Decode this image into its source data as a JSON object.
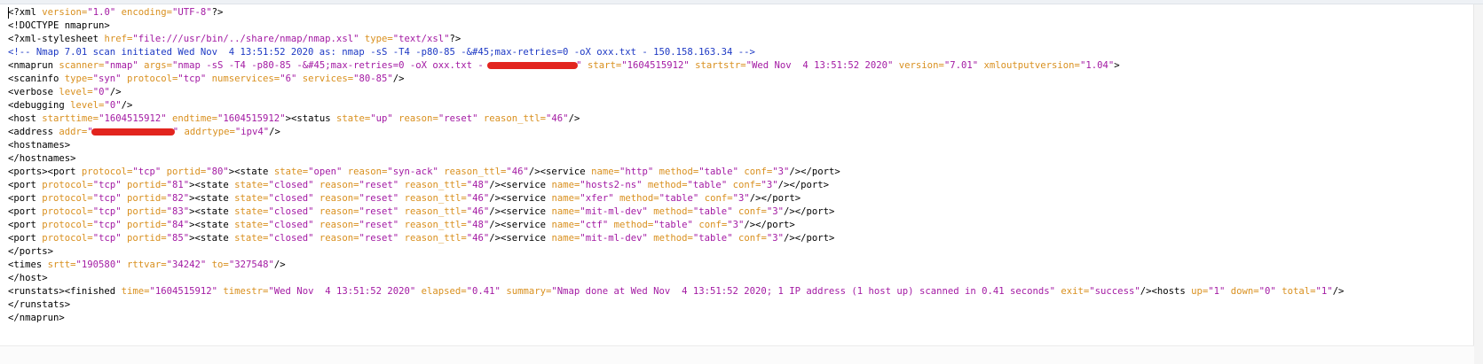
{
  "colors": {
    "text": "#000000",
    "attribute": "#d9901f",
    "value": "#a31aa3",
    "comment": "#1d39c4",
    "redaction": "#e2241e"
  },
  "lines": [
    [
      [
        "t",
        "<?xml "
      ],
      [
        "a",
        "version="
      ],
      [
        "v",
        "\"1.0\""
      ],
      [
        "t",
        " "
      ],
      [
        "a",
        "encoding="
      ],
      [
        "v",
        "\"UTF-8\""
      ],
      [
        "t",
        "?>"
      ]
    ],
    [
      [
        "t",
        "<!DOCTYPE nmaprun>"
      ]
    ],
    [
      [
        "t",
        "<?xml-stylesheet "
      ],
      [
        "a",
        "href="
      ],
      [
        "v",
        "\"file:///usr/bin/../share/nmap/nmap.xsl\""
      ],
      [
        "t",
        " "
      ],
      [
        "a",
        "type="
      ],
      [
        "v",
        "\"text/xsl\""
      ],
      [
        "t",
        "?>"
      ]
    ],
    [
      [
        "c",
        "<!-- Nmap 7.01 scan initiated Wed Nov  4 13:51:52 2020 as: nmap -sS -T4 -p80-85 -&#45;max-retries=0 -oX oxx.txt - 150.158.163.34 -->"
      ]
    ],
    [
      [
        "t",
        "<nmaprun "
      ],
      [
        "a",
        "scanner="
      ],
      [
        "v",
        "\"nmap\""
      ],
      [
        "t",
        " "
      ],
      [
        "a",
        "args="
      ],
      [
        "v",
        "\"nmap -sS -T4 -p80-85 -&#45;max-retries=0 -oX oxx.txt - "
      ],
      [
        "r",
        "102"
      ],
      [
        "v",
        "\""
      ],
      [
        "t",
        " "
      ],
      [
        "a",
        "start="
      ],
      [
        "v",
        "\"1604515912\""
      ],
      [
        "t",
        " "
      ],
      [
        "a",
        "startstr="
      ],
      [
        "v",
        "\"Wed Nov  4 13:51:52 2020\""
      ],
      [
        "t",
        " "
      ],
      [
        "a",
        "version="
      ],
      [
        "v",
        "\"7.01\""
      ],
      [
        "t",
        " "
      ],
      [
        "a",
        "xmloutputversion="
      ],
      [
        "v",
        "\"1.04\""
      ],
      [
        "t",
        ">"
      ]
    ],
    [
      [
        "t",
        "<scaninfo "
      ],
      [
        "a",
        "type="
      ],
      [
        "v",
        "\"syn\""
      ],
      [
        "t",
        " "
      ],
      [
        "a",
        "protocol="
      ],
      [
        "v",
        "\"tcp\""
      ],
      [
        "t",
        " "
      ],
      [
        "a",
        "numservices="
      ],
      [
        "v",
        "\"6\""
      ],
      [
        "t",
        " "
      ],
      [
        "a",
        "services="
      ],
      [
        "v",
        "\"80-85\""
      ],
      [
        "t",
        "/>"
      ]
    ],
    [
      [
        "t",
        "<verbose "
      ],
      [
        "a",
        "level="
      ],
      [
        "v",
        "\"0\""
      ],
      [
        "t",
        "/>"
      ]
    ],
    [
      [
        "t",
        "<debugging "
      ],
      [
        "a",
        "level="
      ],
      [
        "v",
        "\"0\""
      ],
      [
        "t",
        "/>"
      ]
    ],
    [
      [
        "t",
        "<host "
      ],
      [
        "a",
        "starttime="
      ],
      [
        "v",
        "\"1604515912\""
      ],
      [
        "t",
        " "
      ],
      [
        "a",
        "endtime="
      ],
      [
        "v",
        "\"1604515912\""
      ],
      [
        "t",
        "><status "
      ],
      [
        "a",
        "state="
      ],
      [
        "v",
        "\"up\""
      ],
      [
        "t",
        " "
      ],
      [
        "a",
        "reason="
      ],
      [
        "v",
        "\"reset\""
      ],
      [
        "t",
        " "
      ],
      [
        "a",
        "reason_ttl="
      ],
      [
        "v",
        "\"46\""
      ],
      [
        "t",
        "/>"
      ]
    ],
    [
      [
        "t",
        "<address "
      ],
      [
        "a",
        "addr="
      ],
      [
        "v",
        "\""
      ],
      [
        "r",
        "94"
      ],
      [
        "v",
        "\""
      ],
      [
        "t",
        " "
      ],
      [
        "a",
        "addrtype="
      ],
      [
        "v",
        "\"ipv4\""
      ],
      [
        "t",
        "/>"
      ]
    ],
    [
      [
        "t",
        "<hostnames>"
      ]
    ],
    [
      [
        "t",
        "</hostnames>"
      ]
    ],
    [
      [
        "t",
        "<ports><port "
      ],
      [
        "a",
        "protocol="
      ],
      [
        "v",
        "\"tcp\""
      ],
      [
        "t",
        " "
      ],
      [
        "a",
        "portid="
      ],
      [
        "v",
        "\"80\""
      ],
      [
        "t",
        "><state "
      ],
      [
        "a",
        "state="
      ],
      [
        "v",
        "\"open\""
      ],
      [
        "t",
        " "
      ],
      [
        "a",
        "reason="
      ],
      [
        "v",
        "\"syn-ack\""
      ],
      [
        "t",
        " "
      ],
      [
        "a",
        "reason_ttl="
      ],
      [
        "v",
        "\"46\""
      ],
      [
        "t",
        "/><service "
      ],
      [
        "a",
        "name="
      ],
      [
        "v",
        "\"http\""
      ],
      [
        "t",
        " "
      ],
      [
        "a",
        "method="
      ],
      [
        "v",
        "\"table\""
      ],
      [
        "t",
        " "
      ],
      [
        "a",
        "conf="
      ],
      [
        "v",
        "\"3\""
      ],
      [
        "t",
        "/></port>"
      ]
    ],
    [
      [
        "t",
        "<port "
      ],
      [
        "a",
        "protocol="
      ],
      [
        "v",
        "\"tcp\""
      ],
      [
        "t",
        " "
      ],
      [
        "a",
        "portid="
      ],
      [
        "v",
        "\"81\""
      ],
      [
        "t",
        "><state "
      ],
      [
        "a",
        "state="
      ],
      [
        "v",
        "\"closed\""
      ],
      [
        "t",
        " "
      ],
      [
        "a",
        "reason="
      ],
      [
        "v",
        "\"reset\""
      ],
      [
        "t",
        " "
      ],
      [
        "a",
        "reason_ttl="
      ],
      [
        "v",
        "\"48\""
      ],
      [
        "t",
        "/><service "
      ],
      [
        "a",
        "name="
      ],
      [
        "v",
        "\"hosts2-ns\""
      ],
      [
        "t",
        " "
      ],
      [
        "a",
        "method="
      ],
      [
        "v",
        "\"table\""
      ],
      [
        "t",
        " "
      ],
      [
        "a",
        "conf="
      ],
      [
        "v",
        "\"3\""
      ],
      [
        "t",
        "/></port>"
      ]
    ],
    [
      [
        "t",
        "<port "
      ],
      [
        "a",
        "protocol="
      ],
      [
        "v",
        "\"tcp\""
      ],
      [
        "t",
        " "
      ],
      [
        "a",
        "portid="
      ],
      [
        "v",
        "\"82\""
      ],
      [
        "t",
        "><state "
      ],
      [
        "a",
        "state="
      ],
      [
        "v",
        "\"closed\""
      ],
      [
        "t",
        " "
      ],
      [
        "a",
        "reason="
      ],
      [
        "v",
        "\"reset\""
      ],
      [
        "t",
        " "
      ],
      [
        "a",
        "reason_ttl="
      ],
      [
        "v",
        "\"46\""
      ],
      [
        "t",
        "/><service "
      ],
      [
        "a",
        "name="
      ],
      [
        "v",
        "\"xfer\""
      ],
      [
        "t",
        " "
      ],
      [
        "a",
        "method="
      ],
      [
        "v",
        "\"table\""
      ],
      [
        "t",
        " "
      ],
      [
        "a",
        "conf="
      ],
      [
        "v",
        "\"3\""
      ],
      [
        "t",
        "/></port>"
      ]
    ],
    [
      [
        "t",
        "<port "
      ],
      [
        "a",
        "protocol="
      ],
      [
        "v",
        "\"tcp\""
      ],
      [
        "t",
        " "
      ],
      [
        "a",
        "portid="
      ],
      [
        "v",
        "\"83\""
      ],
      [
        "t",
        "><state "
      ],
      [
        "a",
        "state="
      ],
      [
        "v",
        "\"closed\""
      ],
      [
        "t",
        " "
      ],
      [
        "a",
        "reason="
      ],
      [
        "v",
        "\"reset\""
      ],
      [
        "t",
        " "
      ],
      [
        "a",
        "reason_ttl="
      ],
      [
        "v",
        "\"46\""
      ],
      [
        "t",
        "/><service "
      ],
      [
        "a",
        "name="
      ],
      [
        "v",
        "\"mit-ml-dev\""
      ],
      [
        "t",
        " "
      ],
      [
        "a",
        "method="
      ],
      [
        "v",
        "\"table\""
      ],
      [
        "t",
        " "
      ],
      [
        "a",
        "conf="
      ],
      [
        "v",
        "\"3\""
      ],
      [
        "t",
        "/></port>"
      ]
    ],
    [
      [
        "t",
        "<port "
      ],
      [
        "a",
        "protocol="
      ],
      [
        "v",
        "\"tcp\""
      ],
      [
        "t",
        " "
      ],
      [
        "a",
        "portid="
      ],
      [
        "v",
        "\"84\""
      ],
      [
        "t",
        "><state "
      ],
      [
        "a",
        "state="
      ],
      [
        "v",
        "\"closed\""
      ],
      [
        "t",
        " "
      ],
      [
        "a",
        "reason="
      ],
      [
        "v",
        "\"reset\""
      ],
      [
        "t",
        " "
      ],
      [
        "a",
        "reason_ttl="
      ],
      [
        "v",
        "\"48\""
      ],
      [
        "t",
        "/><service "
      ],
      [
        "a",
        "name="
      ],
      [
        "v",
        "\"ctf\""
      ],
      [
        "t",
        " "
      ],
      [
        "a",
        "method="
      ],
      [
        "v",
        "\"table\""
      ],
      [
        "t",
        " "
      ],
      [
        "a",
        "conf="
      ],
      [
        "v",
        "\"3\""
      ],
      [
        "t",
        "/></port>"
      ]
    ],
    [
      [
        "t",
        "<port "
      ],
      [
        "a",
        "protocol="
      ],
      [
        "v",
        "\"tcp\""
      ],
      [
        "t",
        " "
      ],
      [
        "a",
        "portid="
      ],
      [
        "v",
        "\"85\""
      ],
      [
        "t",
        "><state "
      ],
      [
        "a",
        "state="
      ],
      [
        "v",
        "\"closed\""
      ],
      [
        "t",
        " "
      ],
      [
        "a",
        "reason="
      ],
      [
        "v",
        "\"reset\""
      ],
      [
        "t",
        " "
      ],
      [
        "a",
        "reason_ttl="
      ],
      [
        "v",
        "\"46\""
      ],
      [
        "t",
        "/><service "
      ],
      [
        "a",
        "name="
      ],
      [
        "v",
        "\"mit-ml-dev\""
      ],
      [
        "t",
        " "
      ],
      [
        "a",
        "method="
      ],
      [
        "v",
        "\"table\""
      ],
      [
        "t",
        " "
      ],
      [
        "a",
        "conf="
      ],
      [
        "v",
        "\"3\""
      ],
      [
        "t",
        "/></port>"
      ]
    ],
    [
      [
        "t",
        "</ports>"
      ]
    ],
    [
      [
        "t",
        "<times "
      ],
      [
        "a",
        "srtt="
      ],
      [
        "v",
        "\"190580\""
      ],
      [
        "t",
        " "
      ],
      [
        "a",
        "rttvar="
      ],
      [
        "v",
        "\"34242\""
      ],
      [
        "t",
        " "
      ],
      [
        "a",
        "to="
      ],
      [
        "v",
        "\"327548\""
      ],
      [
        "t",
        "/>"
      ]
    ],
    [
      [
        "t",
        "</host>"
      ]
    ],
    [
      [
        "t",
        "<runstats><finished "
      ],
      [
        "a",
        "time="
      ],
      [
        "v",
        "\"1604515912\""
      ],
      [
        "t",
        " "
      ],
      [
        "a",
        "timestr="
      ],
      [
        "v",
        "\"Wed Nov  4 13:51:52 2020\""
      ],
      [
        "t",
        " "
      ],
      [
        "a",
        "elapsed="
      ],
      [
        "v",
        "\"0.41\""
      ],
      [
        "t",
        " "
      ],
      [
        "a",
        "summary="
      ],
      [
        "v",
        "\"Nmap done at Wed Nov  4 13:51:52 2020; 1 IP address (1 host up) scanned in 0.41 seconds\""
      ],
      [
        "t",
        " "
      ],
      [
        "a",
        "exit="
      ],
      [
        "v",
        "\"success\""
      ],
      [
        "t",
        "/><hosts "
      ],
      [
        "a",
        "up="
      ],
      [
        "v",
        "\"1\""
      ],
      [
        "t",
        " "
      ],
      [
        "a",
        "down="
      ],
      [
        "v",
        "\"0\""
      ],
      [
        "t",
        " "
      ],
      [
        "a",
        "total="
      ],
      [
        "v",
        "\"1\""
      ],
      [
        "t",
        "/>"
      ]
    ],
    [
      [
        "t",
        "</runstats>"
      ]
    ],
    [
      [
        "t",
        "</nmaprun>"
      ]
    ]
  ]
}
